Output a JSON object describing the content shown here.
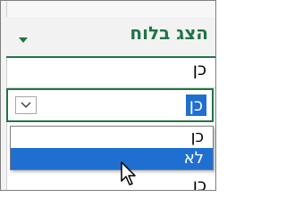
{
  "header": {
    "title": "הצג בלוח"
  },
  "rows": [
    {
      "value": "כן"
    }
  ],
  "active_cell": {
    "value": "כן"
  },
  "dropdown": {
    "options": [
      "כן",
      "לא"
    ],
    "highlighted": "לא"
  },
  "below_row": {
    "value": "כן"
  },
  "colors": {
    "accent_green": "#217346",
    "selection_blue": "#1f6fd0"
  }
}
